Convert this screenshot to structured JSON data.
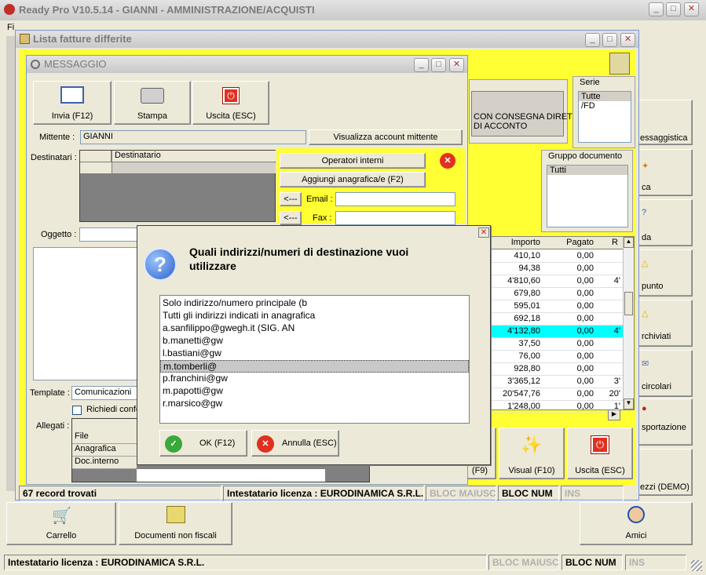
{
  "app": {
    "title": "Ready Pro V10.5.14 - GIANNI - AMMINISTRAZIONE/ACQUISTI",
    "menu_first": "Fi"
  },
  "main_status": {
    "license": "Intestatario licenza : EURODINAMICA S.R.L.",
    "caps": "BLOC MAIUSC",
    "num": "BLOC NUM",
    "ins": "INS"
  },
  "bottom_buttons": {
    "carrello": "Carrello",
    "documenti": "Documenti non fiscali",
    "amici": "Amici"
  },
  "right_buttons": {
    "messaggistica": "essaggistica",
    "ca": "ca",
    "da": "da",
    "punto": "punto",
    "archiviati": "rchiviati",
    "circolari": "circolari",
    "esportazione": "sportazione",
    "prezzi": "ezzi (DEMO)"
  },
  "fatture": {
    "title": "Lista fatture differite",
    "status_records": "67 record trovati",
    "status_license": "Intestatario licenza : EURODINAMICA S.R.L.",
    "caps": "BLOC MAIUSC",
    "num": "BLOC NUM",
    "ins": "INS",
    "consegna_line1": "CON CONSEGNA DIRET",
    "consegna_line2": "DI ACCONTO",
    "serie": {
      "label": "Serie",
      "items": [
        "Tutte",
        "/FD"
      ]
    },
    "gruppo": {
      "label": "Gruppo documento",
      "items": [
        "Tutti"
      ]
    },
    "table": {
      "headers": [
        "Importo",
        "Pagato",
        "R"
      ],
      "rows": [
        [
          "410,10",
          "0,00",
          ""
        ],
        [
          "94,38",
          "0,00",
          ""
        ],
        [
          "4'810,60",
          "0,00",
          "4'"
        ],
        [
          "679,80",
          "0,00",
          ""
        ],
        [
          "595,01",
          "0,00",
          ""
        ],
        [
          "692,18",
          "0,00",
          ""
        ],
        [
          "4'132,80",
          "0,00",
          "4'"
        ],
        [
          "37,50",
          "0,00",
          ""
        ],
        [
          "76,00",
          "0,00",
          ""
        ],
        [
          "928,80",
          "0,00",
          ""
        ],
        [
          "3'365,12",
          "0,00",
          "3'"
        ],
        [
          "20'547,76",
          "0,00",
          "20'"
        ],
        [
          "1'248,00",
          "0,00",
          "1'"
        ]
      ],
      "highlight_row": 6
    },
    "btn_f9": "(F9)",
    "btn_visual": "Visual (F10)",
    "btn_uscita": "Uscita (ESC)"
  },
  "messaggio": {
    "title": "MESSAGGIO",
    "btn_invia": "Invia (F12)",
    "btn_stampa": "Stampa",
    "btn_uscita": "Uscita (ESC)",
    "mittente_label": "Mittente :",
    "mittente_value": "GIANNI",
    "btn_visualizza": "Visualizza account mittente",
    "destinatari_label": "Destinatari :",
    "destinatario_col": "Destinatario",
    "btn_operatori": "Operatori interni",
    "btn_aggiungi": "Aggiungi anagrafica/e (F2)",
    "email_btn": "<---",
    "email_label": "Email :",
    "fax_btn": "<---",
    "fax_label": "Fax :",
    "oggetto_label": "Oggetto :",
    "template_label": "Template :",
    "template_value": "Comunicazioni",
    "richiedi_label": "Richiedi confe",
    "allegati_label": "Allegati :",
    "allegati_rows": [
      "File",
      "Anagrafica",
      "Doc.interno"
    ]
  },
  "dialog": {
    "question": "Quali indirizzi/numeri di destinazione vuoi utilizzare",
    "options": [
      "Solo indirizzo/numero principale (b",
      "Tutti gli indirizzi indicati in anagrafica",
      "a.sanfilippo@gwegh.it (SIG. AN",
      "b.manetti@gw",
      "l.bastiani@gw",
      "m.tomberli@",
      "p.franchini@gw",
      "m.papotti@gw",
      "r.marsico@gw"
    ],
    "selected_index": 5,
    "btn_ok": "OK (F12)",
    "btn_annulla": "Annulla (ESC)"
  }
}
